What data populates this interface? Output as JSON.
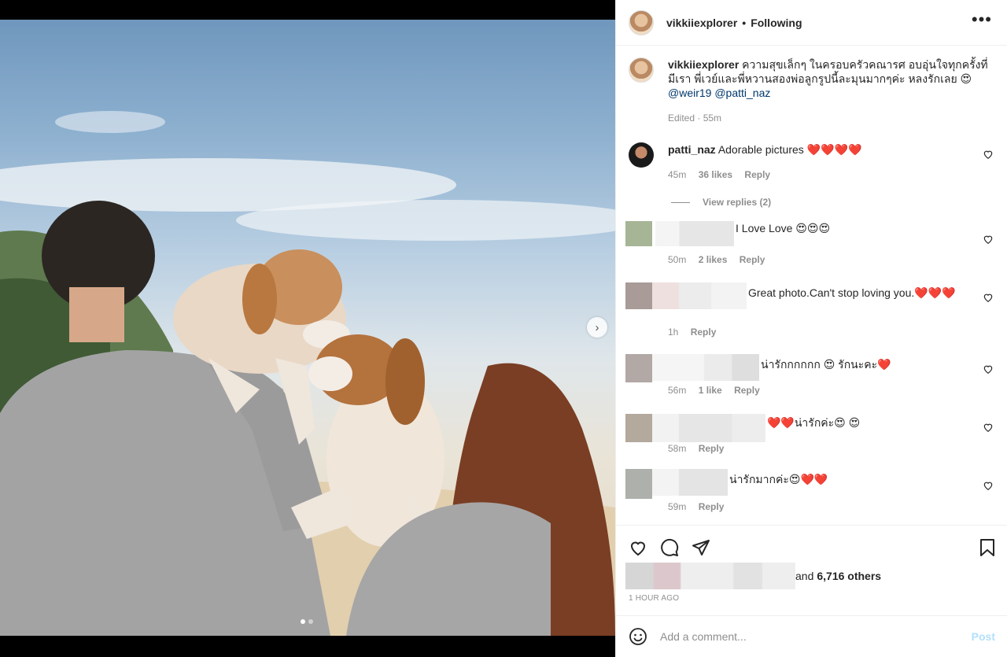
{
  "post": {
    "owner": "vikkiiexplorer",
    "separator": "•",
    "follow_status": "Following",
    "more_icon": "more-horizontal-icon",
    "caption_text": "ความสุขเล็กๆ ในครอบครัวคณารศ อบอุ่นใจทุกครั้งที่มีเรา พี่เวย์และพี่หวานสองพ่อลูกรูปนี้ละมุนมากๆค่ะ หลงรักเลย 😍",
    "mention_1": "@weir19",
    "mention_2": "@patti_naz",
    "caption_meta": "Edited · 55m",
    "next_icon": "chevron-right-icon",
    "carousel": {
      "slides": 2,
      "active": 1
    }
  },
  "comments": [
    {
      "username": "patti_naz",
      "text": "Adorable pictures ❤️❤️❤️❤️",
      "time": "45m",
      "likes": "36 likes",
      "reply": "Reply"
    },
    {
      "username": "",
      "text": "I Love Love 😍😍😍",
      "time": "50m",
      "likes": "2 likes",
      "reply": "Reply"
    },
    {
      "username": "",
      "text": "Great photo.Can't stop loving you.❤️❤️❤️",
      "time": "1h",
      "likes": "",
      "reply": "Reply"
    },
    {
      "username": "",
      "text": "น่ารักกกกกก 😍 รักนะคะ❤️",
      "time": "56m",
      "likes": "1 like",
      "reply": "Reply"
    },
    {
      "username": "",
      "text": "❤️❤️น่ารักค่ะ😍 😍",
      "time": "58m",
      "likes": "",
      "reply": "Reply"
    },
    {
      "username": "",
      "text": "น่ารักมากค่ะ😍❤️❤️",
      "time": "59m",
      "likes": "",
      "reply": "Reply"
    }
  ],
  "view_replies": "View replies (2)",
  "likes_summary": {
    "prefix": "and",
    "count": "6,716 others"
  },
  "time_ago": "1 HOUR AGO",
  "add_comment": {
    "placeholder": "Add a comment...",
    "post_label": "Post"
  },
  "icons": {
    "like": "heart-icon",
    "comment": "comment-icon",
    "share": "share-icon",
    "save": "bookmark-icon",
    "emoji": "emoji-icon"
  },
  "colors": {
    "link": "#00376b",
    "post_disabled": "#b2dffc",
    "meta": "#8e8e8e"
  }
}
